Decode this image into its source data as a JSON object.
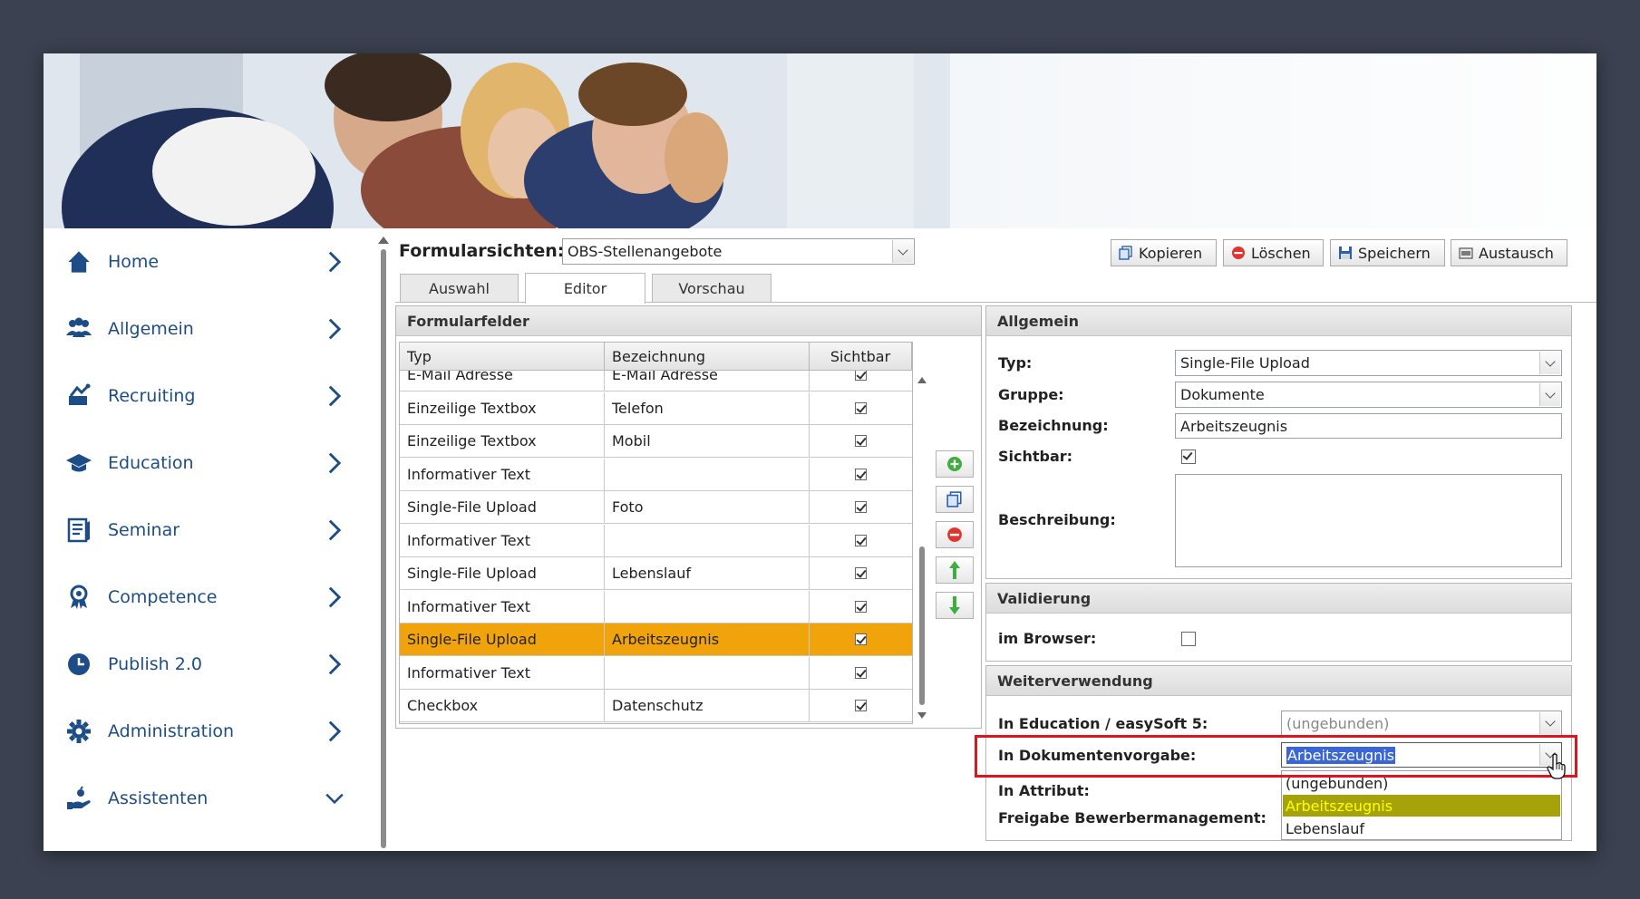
{
  "sidebar": {
    "items": [
      {
        "label": "Home",
        "icon": "home-icon"
      },
      {
        "label": "Allgemein",
        "icon": "users-icon"
      },
      {
        "label": "Recruiting",
        "icon": "recruiting-icon"
      },
      {
        "label": "Education",
        "icon": "graduation-cap-icon"
      },
      {
        "label": "Seminar",
        "icon": "document-icon"
      },
      {
        "label": "Competence",
        "icon": "award-icon"
      },
      {
        "label": "Publish 2.0",
        "icon": "clock-icon"
      },
      {
        "label": "Administration",
        "icon": "gear-icon"
      },
      {
        "label": "Assistenten",
        "icon": "assistant-hand-icon"
      }
    ]
  },
  "header": {
    "title": "Formularsichten:",
    "select_value": "OBS-Stellenangebote",
    "buttons": {
      "copy": "Kopieren",
      "delete": "Löschen",
      "save": "Speichern",
      "exchange": "Austausch"
    }
  },
  "tabs": [
    {
      "label": "Auswahl"
    },
    {
      "label": "Editor"
    },
    {
      "label": "Vorschau"
    }
  ],
  "form_fields": {
    "title": "Formularfelder",
    "columns": {
      "type": "Typ",
      "name": "Bezeichnung",
      "visible": "Sichtbar"
    },
    "rows": [
      {
        "type": "E-Mail Adresse",
        "name": "E-Mail Adresse",
        "visible": true
      },
      {
        "type": "Einzeilige Textbox",
        "name": "Telefon",
        "visible": true
      },
      {
        "type": "Einzeilige Textbox",
        "name": "Mobil",
        "visible": true
      },
      {
        "type": "Informativer Text",
        "name": "",
        "visible": true
      },
      {
        "type": "Single-File Upload",
        "name": "Foto",
        "visible": true
      },
      {
        "type": "Informativer Text",
        "name": "",
        "visible": true
      },
      {
        "type": "Single-File Upload",
        "name": "Lebenslauf",
        "visible": true
      },
      {
        "type": "Informativer Text",
        "name": "",
        "visible": true
      },
      {
        "type": "Single-File Upload",
        "name": "Arbeitszeugnis",
        "visible": true,
        "selected": true
      },
      {
        "type": "Informativer Text",
        "name": "",
        "visible": true
      },
      {
        "type": "Checkbox",
        "name": "Datenschutz",
        "visible": true
      }
    ]
  },
  "general": {
    "title": "Allgemein",
    "type_label": "Typ:",
    "type_value": "Single-File Upload",
    "group_label": "Gruppe:",
    "group_value": "Dokumente",
    "name_label": "Bezeichnung:",
    "name_value": "Arbeitszeugnis",
    "visible_label": "Sichtbar:",
    "visible_value": true,
    "desc_label": "Beschreibung:",
    "desc_value": ""
  },
  "validation": {
    "title": "Validierung",
    "browser_label": "im Browser:",
    "browser_value": false
  },
  "reuse": {
    "title": "Weiterverwendung",
    "education_label": "In Education / easySoft 5:",
    "education_value": "(ungebunden)",
    "docs_label": "In Dokumentenvorgabe:",
    "docs_value": "Arbeitszeugnis",
    "attr_label": "In Attribut:",
    "release_label": "Freigabe Bewerbermanagement:",
    "options": [
      "(ungebunden)",
      "Arbeitszeugnis",
      "Lebenslauf"
    ],
    "highlighted_option": "Arbeitszeugnis"
  },
  "colors": {
    "brand": "#1d4d86",
    "selected_row": "#f0a30a",
    "option_highlight": "#a6a20a",
    "option_highlight_text": "#ffff00",
    "callout": "#e0141e",
    "text_selection": "#3b67d6"
  }
}
